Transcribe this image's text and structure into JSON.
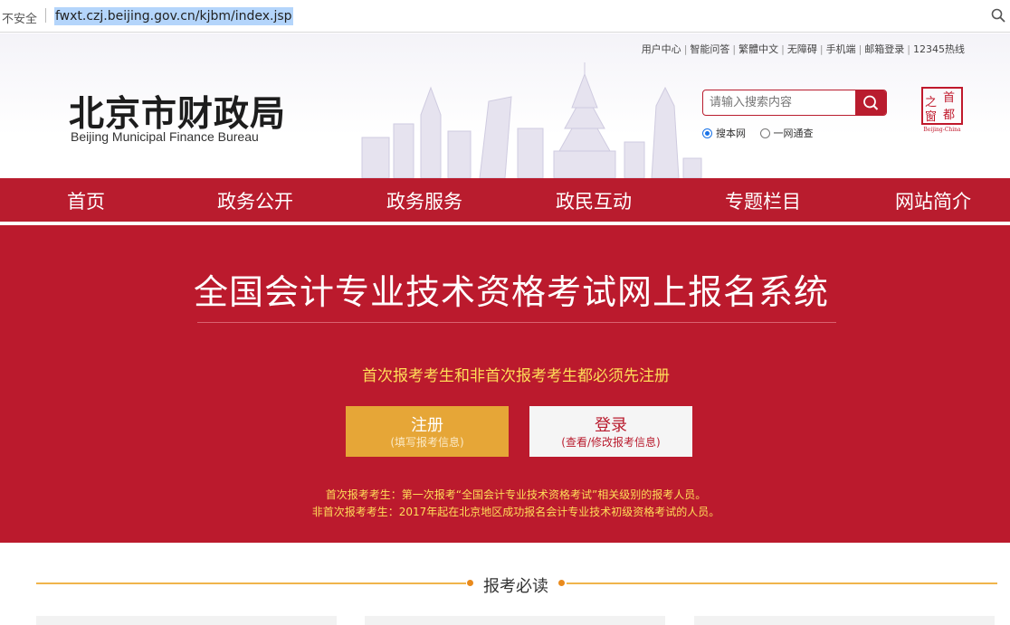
{
  "address_bar": {
    "security_label": "不安全",
    "url": "fwxt.czj.beijing.gov.cn/kjbm/index.jsp"
  },
  "header": {
    "top_links": [
      "用户中心",
      "智能问答",
      "繁體中文",
      "无障碍",
      "手机端",
      "邮箱登录",
      "12345热线"
    ],
    "logo_cn": "北京市财政局",
    "logo_en": "Beijing Municipal Finance Bureau",
    "search": {
      "placeholder": "请输入搜索内容",
      "options": [
        {
          "label": "搜本网",
          "selected": true
        },
        {
          "label": "一网通查",
          "selected": false
        }
      ]
    },
    "seal": {
      "chars": [
        "之",
        "首",
        "都",
        "窗"
      ],
      "caption": "Beijing-China"
    }
  },
  "nav": {
    "items": [
      "首页",
      "政务公开",
      "政务服务",
      "政民互动",
      "专题栏目",
      "网站简介"
    ]
  },
  "banner": {
    "title": "全国会计专业技术资格考试网上报名系统",
    "notice": "首次报考考生和非首次报考考生都必须先注册",
    "register": {
      "label": "注册",
      "sub": "(填写报考信息)"
    },
    "login": {
      "label": "登录",
      "sub": "(查看/修改报考信息)"
    },
    "explanations": [
      "首次报考考生：第一次报考“全国会计专业技术资格考试”相关级别的报考人员。",
      "非首次报考考生：2017年起在北京地区成功报名会计专业技术初级资格考试的人员。"
    ]
  },
  "section": {
    "title": "报考必读"
  },
  "colors": {
    "brand_red": "#bb1a2d",
    "accent_yellow": "#ffde59",
    "register_orange": "#e6a637",
    "section_line": "#f0b44b"
  }
}
